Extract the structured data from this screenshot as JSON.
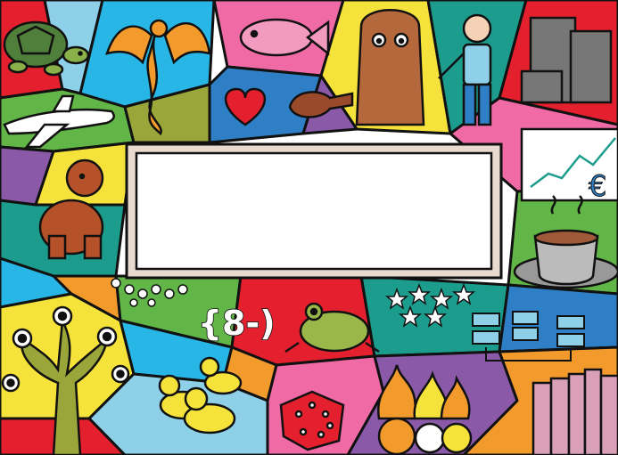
{
  "scene": {
    "emoticon": "{8-)",
    "center_card_text": "",
    "palette": {
      "outline": "#111111",
      "card_fill": "#ffffff",
      "card_border": "#e9d9cf",
      "red": "#e5202e",
      "pink": "#f06aa6",
      "cyan": "#27b6e6",
      "green": "#62b547",
      "yellow": "#f5e23a",
      "orange": "#f39a2c",
      "purple": "#8a5aa8",
      "teal": "#1c9c8c",
      "olive": "#9aa53a",
      "blue": "#2f7fc6"
    },
    "illustrations": [
      "turtle-icon",
      "dragon-icon",
      "fish-icon",
      "bigfoot-icon",
      "man-icon",
      "buildings-icon",
      "airplane-icon",
      "heart-icon",
      "chart-icon",
      "dog-icon",
      "coffee-cup-icon",
      "eye-tree-icon",
      "frog-icon",
      "stars-icon",
      "flowchart-icon",
      "ducks-icon",
      "dice-icon",
      "flame-heads-icon",
      "books-icon"
    ]
  }
}
